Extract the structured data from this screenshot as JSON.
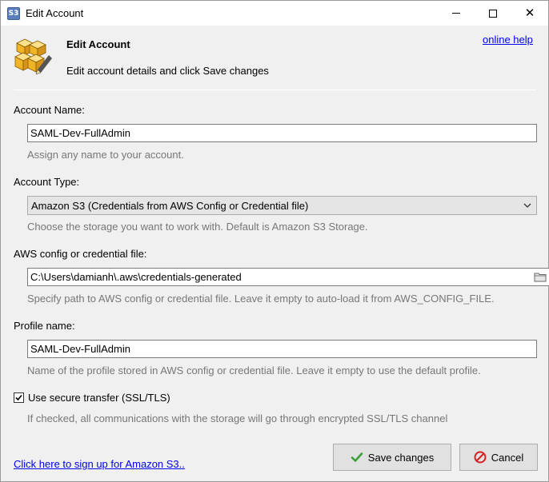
{
  "window": {
    "title": "Edit Account",
    "app_icon_text": "S3",
    "close_glyph": "✕"
  },
  "header": {
    "title": "Edit Account",
    "subtitle": "Edit account details and click Save changes",
    "help_link": "online help"
  },
  "account_name": {
    "label": "Account Name:",
    "value": "SAML-Dev-FullAdmin",
    "hint": "Assign any name to your account."
  },
  "account_type": {
    "label": "Account Type:",
    "selected": "Amazon S3 (Credentials from AWS Config or Credential file)",
    "hint": "Choose the storage you want to work with. Default is Amazon S3 Storage."
  },
  "config_file": {
    "label": "AWS config or credential file:",
    "value": "C:\\Users\\damianh\\.aws\\credentials-generated",
    "hint": "Specify path to AWS config or credential file. Leave it empty to auto-load it from AWS_CONFIG_FILE."
  },
  "profile": {
    "label": "Profile name:",
    "value": "SAML-Dev-FullAdmin",
    "hint": "Name of the profile stored in AWS config or credential file. Leave it empty to use the default profile."
  },
  "secure_transfer": {
    "label": "Use secure transfer (SSL/TLS)",
    "checked": true,
    "hint": "If checked, all communications with the storage will go through encrypted SSL/TLS channel"
  },
  "footer": {
    "signup_link": "Click here to sign up for Amazon S3..",
    "save_label": "Save changes",
    "cancel_label": "Cancel"
  },
  "colors": {
    "link": "#0000ee",
    "hint_text": "#777777",
    "header_icon": "#f0b428",
    "save_check": "#3aa03a",
    "cancel_red": "#d62020"
  },
  "icons": {
    "app": "s3-app-icon",
    "header": "cubes-pencil-icon",
    "folder": "folder-icon",
    "save": "checkmark-icon",
    "cancel": "cancel-circle-icon"
  }
}
